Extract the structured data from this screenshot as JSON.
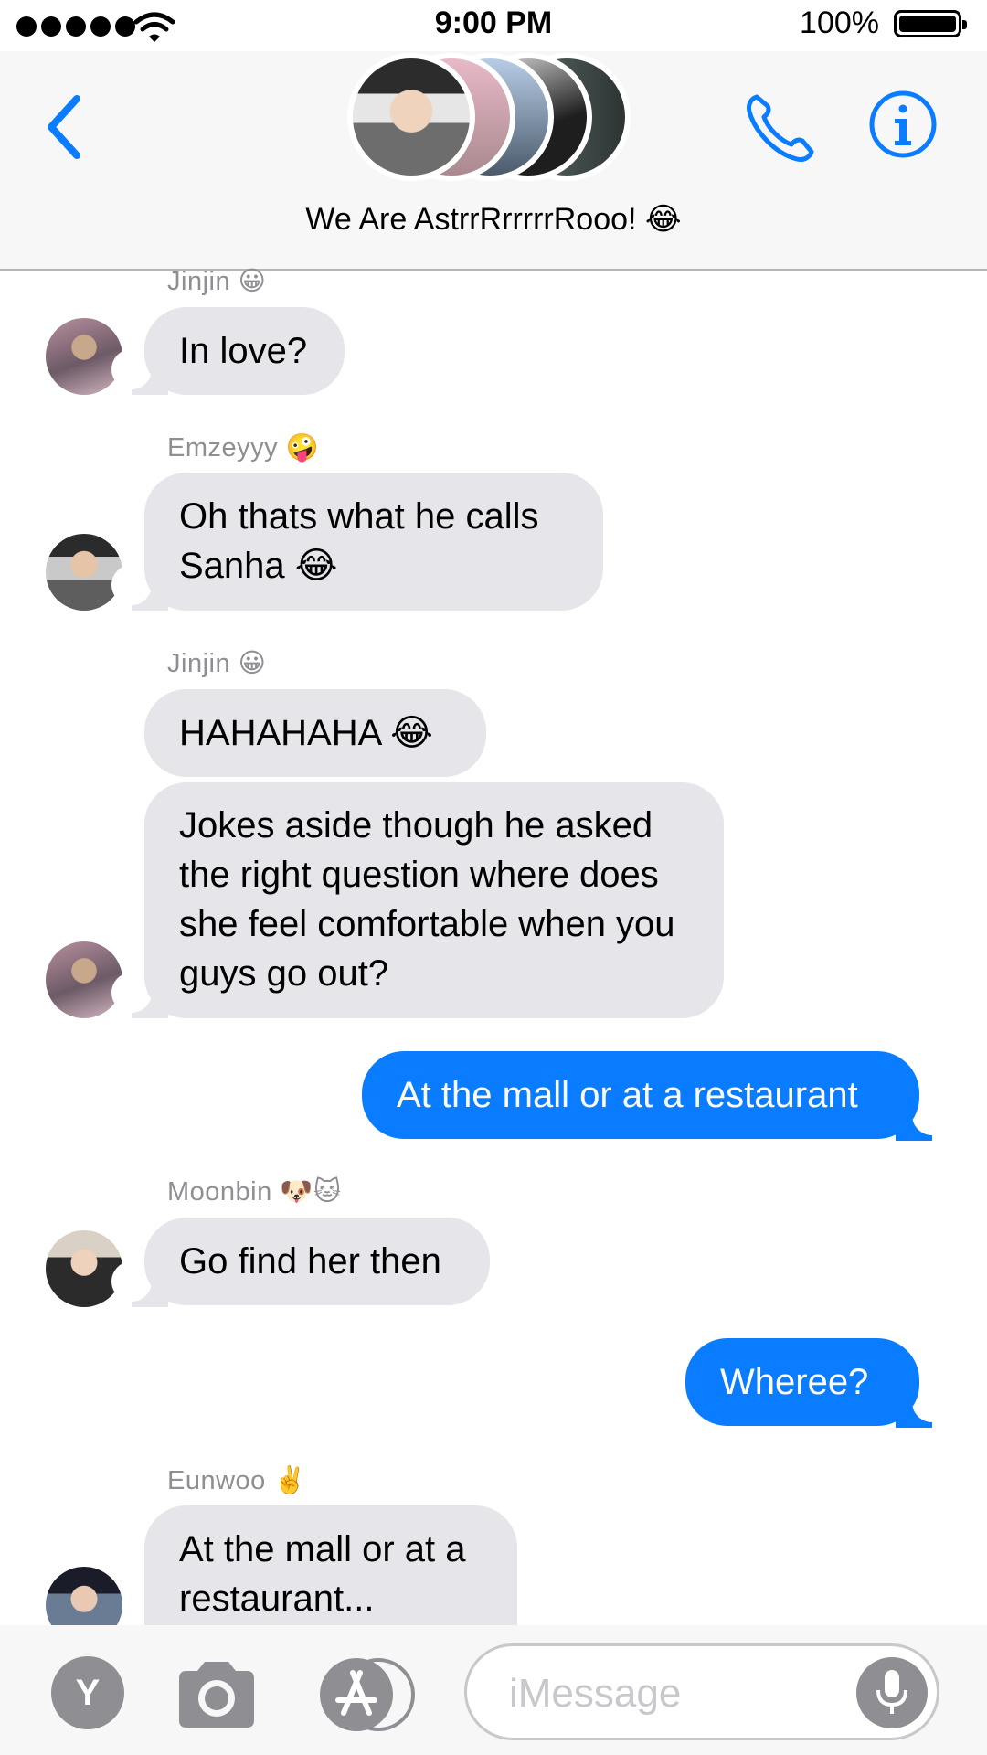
{
  "status_bar": {
    "time": "9:00 PM",
    "battery": "100%",
    "icons": [
      "signal-icon",
      "wifi-icon",
      "battery-icon"
    ]
  },
  "header": {
    "group_name": "We Are AstrrRrrrrrRooo! 😂",
    "buttons": [
      "back-icon",
      "phone-icon",
      "info-icon"
    ],
    "accent_color": "#0a7cff"
  },
  "messages": [
    {
      "sender": "Jinjin 😀",
      "direction": "incoming",
      "text": "In love?"
    },
    {
      "sender": "Emzeyyy 🤪",
      "direction": "incoming",
      "text": "Oh thats what he calls Sanha 😂"
    },
    {
      "sender": "Jinjin 😀",
      "direction": "incoming",
      "text": "HAHAHAHA 😂"
    },
    {
      "sender": "",
      "direction": "incoming",
      "text": "Jokes aside though he asked the right question where does she feel comfortable when you guys go out?"
    },
    {
      "sender": "",
      "direction": "outgoing",
      "text": "At the mall or at a restaurant"
    },
    {
      "sender": "Moonbin 🐶🐱",
      "direction": "incoming",
      "text": "Go find her then"
    },
    {
      "sender": "",
      "direction": "outgoing",
      "text": "Wheree?"
    },
    {
      "sender": "Eunwoo ✌️",
      "direction": "incoming",
      "text": "At the mall or at a restaurant..."
    }
  ],
  "compose": {
    "apps_label": "Y",
    "placeholder": "iMessage",
    "icons": [
      "camera-icon",
      "app-store-icon",
      "microphone-icon"
    ]
  },
  "colors": {
    "incoming_bubble": "#e5e5ea",
    "outgoing_bubble": "#0a7cff",
    "sender_label": "#8e8e93"
  }
}
